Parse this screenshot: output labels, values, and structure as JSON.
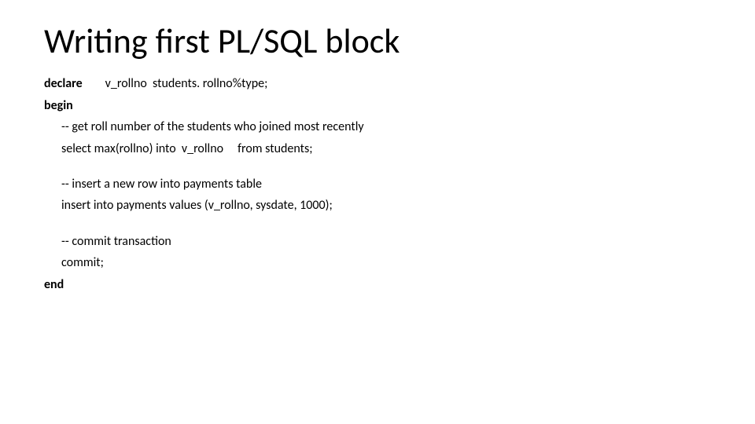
{
  "title": "Writing first PL/SQL block",
  "code": {
    "declare_kw": "declare",
    "declare_rest": "        v_rollno  students. rollno%type;",
    "begin_kw": "begin",
    "comment1": "-- get roll number of the students who joined most recently",
    "select_line": "select max(rollno) into  v_rollno     from students;",
    "comment2": "-- insert a new row into payments table",
    "insert_line": "insert into payments values (v_rollno, sysdate, 1000);",
    "comment3": "-- commit transaction",
    "commit_line": "commit;",
    "end_kw": "end"
  }
}
